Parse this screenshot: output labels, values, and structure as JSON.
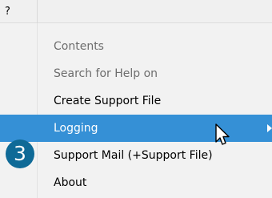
{
  "menubar": {
    "help_label": "?"
  },
  "menu": {
    "items": [
      {
        "label": "Contents",
        "state": "disabled"
      },
      {
        "label": "Search for Help on",
        "state": "disabled"
      },
      {
        "label": "Create Support File",
        "state": "enabled"
      },
      {
        "label": "Logging",
        "state": "highlighted",
        "has_submenu": true
      },
      {
        "label": "Support Mail (+Support File)",
        "state": "enabled"
      },
      {
        "label": "About",
        "state": "enabled"
      }
    ],
    "highlight_color": "#3590d6"
  },
  "annotation": {
    "step_number": "3",
    "badge_color": "#0f6a97"
  },
  "cursor": {
    "icon": "arrow-pointer-icon"
  }
}
